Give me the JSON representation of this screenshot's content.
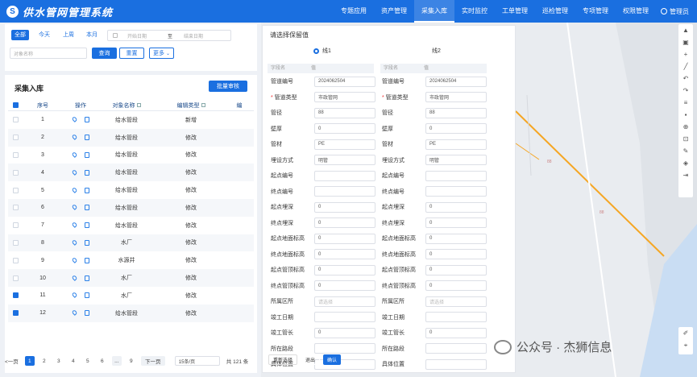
{
  "app": {
    "title": "供水管网管理系统",
    "logo_letter": "S"
  },
  "nav": [
    "专题应用",
    "资产管理",
    "采集入库",
    "实时监控",
    "工单管理",
    "巡检管理",
    "专项管理",
    "权限管理"
  ],
  "user": {
    "name": "管理员"
  },
  "filter": {
    "ranges": [
      "全部",
      "今天",
      "上周",
      "本月"
    ],
    "date_start_placeholder": "开始日期",
    "date_separator": "至",
    "date_end_placeholder": "结束日期",
    "name_placeholder": "对象名称",
    "query": "查询",
    "reset": "重置",
    "more": "更多"
  },
  "list": {
    "title": "采集入库",
    "batch_review": "批量审核",
    "columns": [
      "序号",
      "操作",
      "对象名称",
      "编辑类型",
      "编"
    ],
    "rows": [
      {
        "no": "1",
        "name": "给水管段",
        "type": "新增",
        "checked": false
      },
      {
        "no": "2",
        "name": "给水管段",
        "type": "修改",
        "checked": false
      },
      {
        "no": "3",
        "name": "给水管段",
        "type": "修改",
        "checked": false
      },
      {
        "no": "4",
        "name": "给水管段",
        "type": "修改",
        "checked": false
      },
      {
        "no": "5",
        "name": "给水管段",
        "type": "修改",
        "checked": false
      },
      {
        "no": "6",
        "name": "给水管段",
        "type": "修改",
        "checked": false
      },
      {
        "no": "7",
        "name": "给水管段",
        "type": "修改",
        "checked": false
      },
      {
        "no": "8",
        "name": "水厂",
        "type": "修改",
        "checked": false
      },
      {
        "no": "9",
        "name": "水源井",
        "type": "修改",
        "checked": false
      },
      {
        "no": "10",
        "name": "水厂",
        "type": "修改",
        "checked": false
      },
      {
        "no": "11",
        "name": "水厂",
        "type": "修改",
        "checked": true
      },
      {
        "no": "12",
        "name": "给水管段",
        "type": "修改",
        "checked": true
      }
    ],
    "pager": {
      "prev": "<一页",
      "pages": [
        "1",
        "2",
        "3",
        "4",
        "5",
        "6",
        "...",
        "9"
      ],
      "next": "下一页",
      "size": "15条/页",
      "total": "共 121 条"
    }
  },
  "dialog": {
    "title": "请选择保留值",
    "option1": "线1",
    "option2": "线2",
    "hdr_field": "字段名",
    "hdr_value": "值",
    "fields": [
      "管道编号",
      "管道类型",
      "管径",
      "壁厚",
      "管材",
      "埋设方式",
      "起点编号",
      "终点编号",
      "起点埋深",
      "终点埋深",
      "起点地面标高",
      "终点地面标高",
      "起点管顶标高",
      "终点管顶标高",
      "所属区所",
      "竣工日期",
      "竣工管长",
      "所在路段",
      "具体位置"
    ],
    "required": [
      false,
      true,
      false,
      false,
      false,
      false,
      false,
      false,
      false,
      false,
      false,
      false,
      false,
      false,
      false,
      false,
      false,
      false,
      false
    ],
    "left_values": [
      "2024062504",
      "市政管网",
      "88",
      "0",
      "PE",
      "明管",
      "",
      "",
      "0",
      "0",
      "0",
      "0",
      "0",
      "0",
      "请选择",
      "",
      "0",
      "",
      ""
    ],
    "right_values": [
      "2024062504",
      "市政管网",
      "88",
      "0",
      "PE",
      "明管",
      "",
      "",
      "0",
      "0",
      "0",
      "0",
      "0",
      "0",
      "请选择",
      "",
      "0",
      "",
      ""
    ],
    "buttons": [
      "重新选择",
      "退出",
      "确认"
    ]
  },
  "map": {
    "label1": "88",
    "label2": "88"
  },
  "watermark": "公众号 · 杰狮信息"
}
